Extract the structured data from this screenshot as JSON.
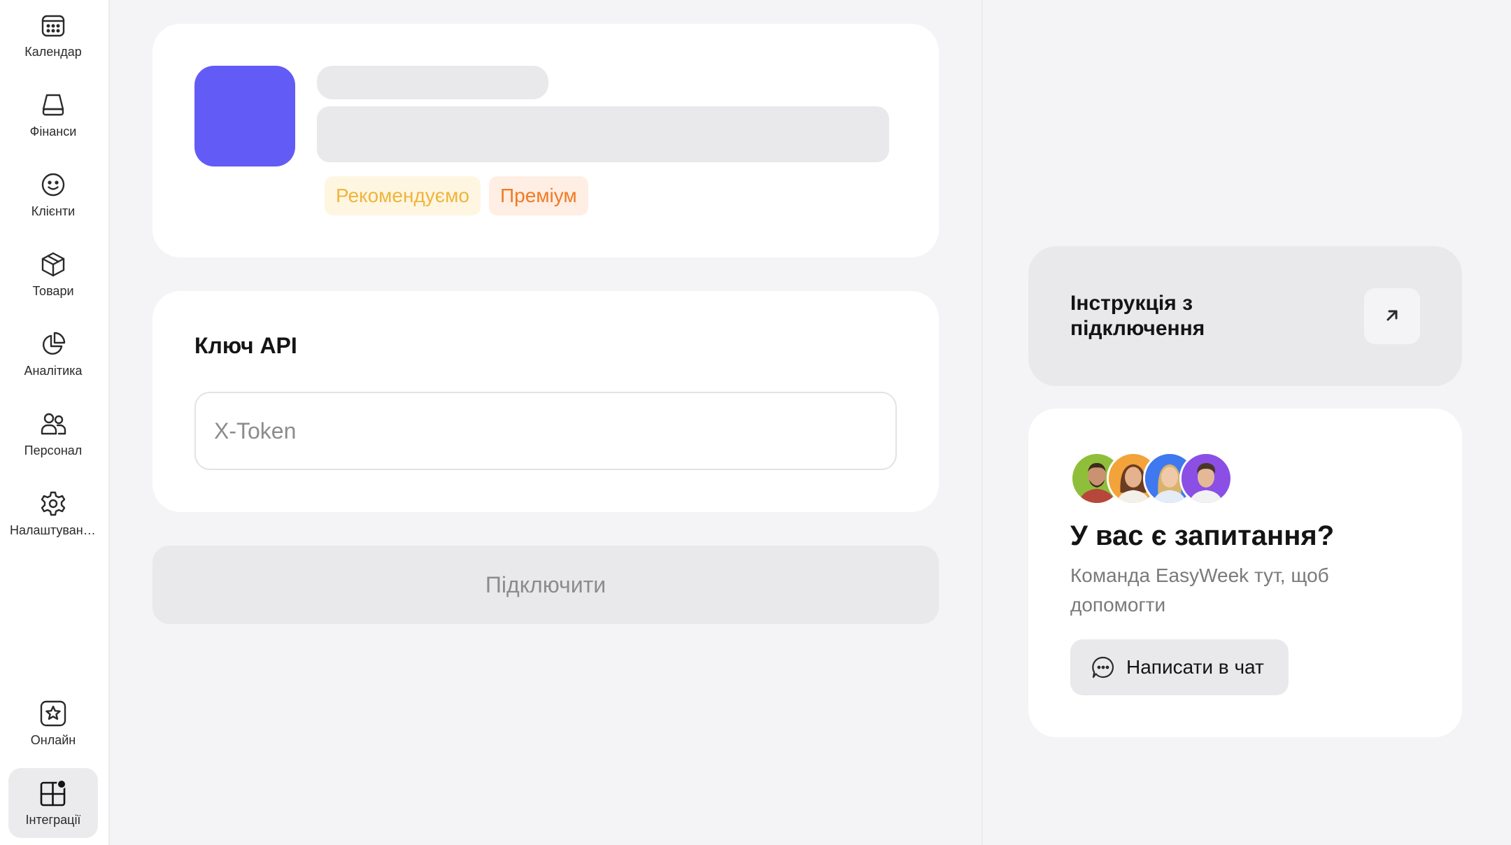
{
  "sidebar": {
    "items": [
      {
        "label": "Календар",
        "icon": "calendar-icon"
      },
      {
        "label": "Фінанси",
        "icon": "finance-icon"
      },
      {
        "label": "Клієнти",
        "icon": "smiley-icon"
      },
      {
        "label": "Товари",
        "icon": "box-icon"
      },
      {
        "label": "Аналітика",
        "icon": "pie-chart-icon"
      },
      {
        "label": "Персонал",
        "icon": "users-icon"
      },
      {
        "label": "Налаштування",
        "icon": "gear-icon"
      }
    ],
    "bottom": [
      {
        "label": "Онлайн",
        "icon": "star-icon"
      },
      {
        "label": "Інтеграції",
        "icon": "grid-icon"
      }
    ]
  },
  "integration": {
    "badges": {
      "recommended": "Рекомендуємо",
      "premium": "Преміум"
    },
    "logo_color": "#625BF6"
  },
  "api": {
    "title": "Ключ API",
    "placeholder": "X-Token",
    "value": ""
  },
  "connect": {
    "label": "Підключити"
  },
  "instructions": {
    "text": "Інструкція з підключення",
    "icon": "arrow-up-right-icon"
  },
  "help": {
    "title": "У вас є запитання?",
    "subtitle": "Команда EasyWeek тут, щоб допомогти",
    "chat_label": "Написати в чат",
    "chat_icon": "chat-bubble-icon"
  },
  "colors": {
    "accent": "#625BF6",
    "badge_recommended": "#F0B43B",
    "badge_premium": "#F07B26"
  }
}
